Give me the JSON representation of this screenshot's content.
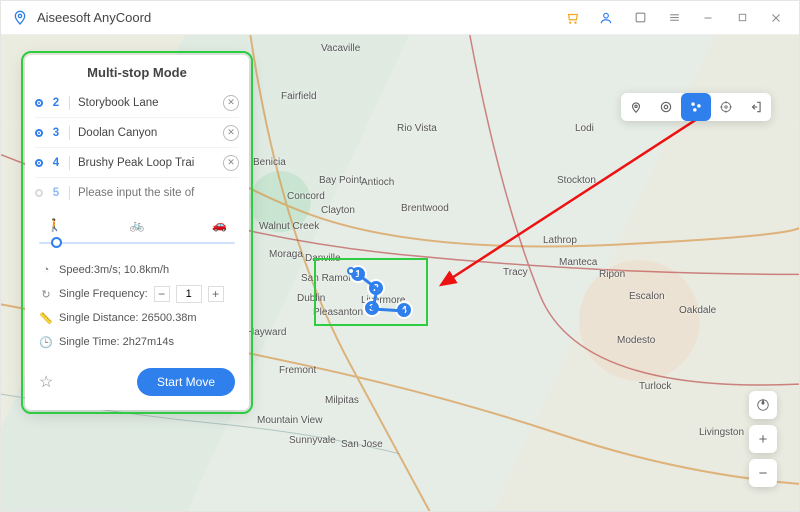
{
  "titlebar": {
    "app_name": "Aiseesoft AnyCoord"
  },
  "panel": {
    "title": "Multi-stop Mode",
    "stops": [
      {
        "index": "2",
        "text": "Storybook Lane"
      },
      {
        "index": "3",
        "text": "Doolan Canyon"
      },
      {
        "index": "4",
        "text": "Brushy Peak Loop Trai"
      }
    ],
    "empty_stop_index": "5",
    "empty_stop_placeholder": "Please input the site of",
    "speed_label": "Speed:3m/s; 10.8km/h",
    "frequency_label": "Single Frequency:",
    "frequency_value": "1",
    "distance_label": "Single Distance: 26500.38m",
    "time_label": "Single Time: 2h27m14s",
    "start_button": "Start Move"
  },
  "map": {
    "labels": {
      "vacaville": "Vacaville",
      "fairfield": "Fairfield",
      "riovista": "Rio Vista",
      "antioch": "Antioch",
      "brentwood": "Brentwood",
      "concord": "Concord",
      "baypoint": "Bay Point",
      "clayton": "Clayton",
      "walnutcreek": "Walnut Creek",
      "moraga": "Moraga",
      "danville": "Danville",
      "sanramon": "San Ramon",
      "dublin": "Dublin",
      "pleasanton": "Pleasanton",
      "livermore": "Livermore",
      "tracy": "Tracy",
      "stockton": "Stockton",
      "manteca": "Manteca",
      "lathrop": "Lathrop",
      "ripon": "Ripon",
      "escalon": "Escalon",
      "modesto": "Modesto",
      "oakdale": "Oakdale",
      "hayward": "Hayward",
      "fremont": "Fremont",
      "milpitas": "Milpitas",
      "sanjose": "San Jose",
      "mountainview": "Mountain View",
      "sunnyvale": "Sunnyvale",
      "livingston": "Livingston",
      "turlock": "Turlock",
      "lodi": "Lodi",
      "benicia": "Benicia"
    },
    "markers": [
      "1",
      "2",
      "3",
      "4"
    ]
  }
}
